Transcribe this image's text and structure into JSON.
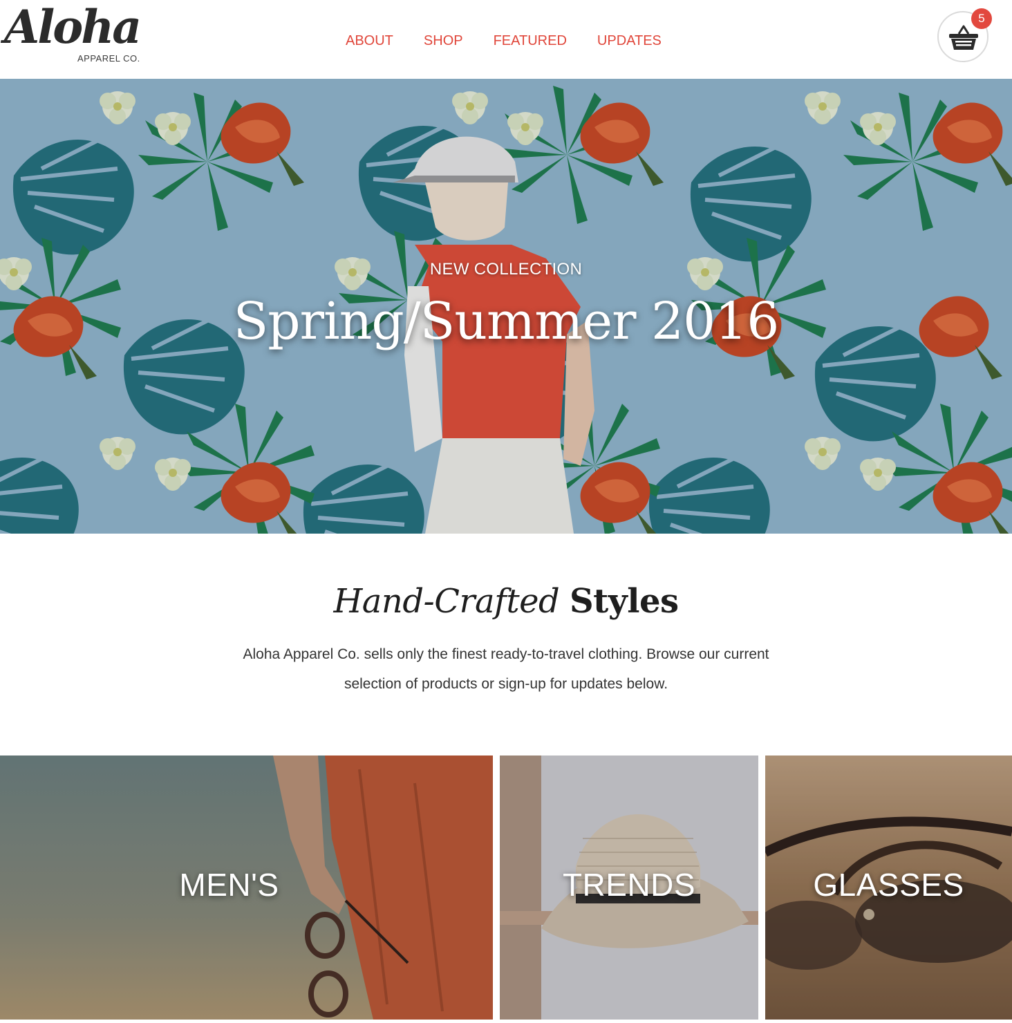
{
  "brand": {
    "logo_script": "Aloha",
    "logo_sub": "APPAREL CO."
  },
  "nav": {
    "items": [
      {
        "label": "ABOUT"
      },
      {
        "label": "SHOP"
      },
      {
        "label": "FEATURED"
      },
      {
        "label": "UPDATES"
      }
    ]
  },
  "cart": {
    "icon": "basket-icon",
    "count": "5"
  },
  "hero": {
    "eyebrow": "NEW COLLECTION",
    "title": "Spring/Summer 2016"
  },
  "intro": {
    "title_italic": "Hand-Crafted",
    "title_bold": "Styles",
    "text": "Aloha Apparel Co. sells only the finest ready-to-travel clothing. Browse our current selection of products or sign-up for updates below."
  },
  "categories": [
    {
      "label": "MEN'S"
    },
    {
      "label": "TRENDS"
    },
    {
      "label": "GLASSES"
    }
  ],
  "colors": {
    "accent": "#e0463a",
    "badge": "#e2483e",
    "text_dark": "#1e1e1e"
  }
}
